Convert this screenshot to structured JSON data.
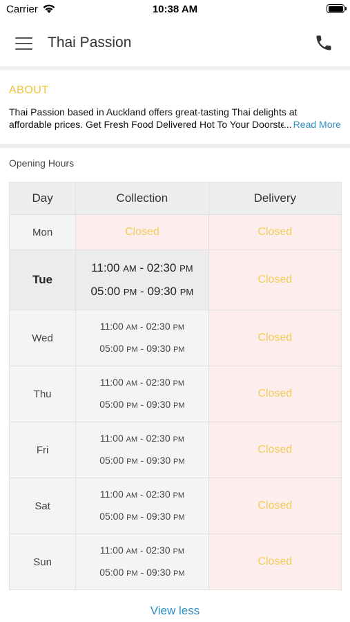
{
  "status_bar": {
    "carrier": "Carrier",
    "time": "10:38 AM"
  },
  "header": {
    "title": "Thai Passion",
    "menu_icon": "hamburger-icon",
    "phone_icon": "phone-icon"
  },
  "about": {
    "heading": "ABOUT",
    "line1": "Thai Passion based in Auckland offers great-tasting Thai delights at",
    "line2": "affordable prices. Get Fresh Food Delivered Hot To Your Doorstep...",
    "ellipsis": "...",
    "read_more": "Read More"
  },
  "hours": {
    "label": "Opening Hours",
    "columns": {
      "day": "Day",
      "collection": "Collection",
      "delivery": "Delivery"
    },
    "days": [
      {
        "day": "Mon",
        "collection_closed": "Closed",
        "delivery": "Closed"
      },
      {
        "day": "Tue",
        "s1_start": "11:00",
        "s1_start_ampm": "AM",
        "sep": " - ",
        "s1_end": "02:30",
        "s1_end_ampm": "PM",
        "s2_start": "05:00",
        "s2_start_ampm": "PM",
        "s2_end": "09:30",
        "s2_end_ampm": "PM",
        "delivery": "Closed"
      },
      {
        "day": "Wed",
        "s1_start": "11:00",
        "s1_start_ampm": "AM",
        "sep": " - ",
        "s1_end": "02:30",
        "s1_end_ampm": "PM",
        "s2_start": "05:00",
        "s2_start_ampm": "PM",
        "s2_end": "09:30",
        "s2_end_ampm": "PM",
        "delivery": "Closed"
      },
      {
        "day": "Thu",
        "s1_start": "11:00",
        "s1_start_ampm": "AM",
        "sep": " - ",
        "s1_end": "02:30",
        "s1_end_ampm": "PM",
        "s2_start": "05:00",
        "s2_start_ampm": "PM",
        "s2_end": "09:30",
        "s2_end_ampm": "PM",
        "delivery": "Closed"
      },
      {
        "day": "Fri",
        "s1_start": "11:00",
        "s1_start_ampm": "AM",
        "sep": " - ",
        "s1_end": "02:30",
        "s1_end_ampm": "PM",
        "s2_start": "05:00",
        "s2_start_ampm": "PM",
        "s2_end": "09:30",
        "s2_end_ampm": "PM",
        "delivery": "Closed"
      },
      {
        "day": "Sat",
        "s1_start": "11:00",
        "s1_start_ampm": "AM",
        "sep": " - ",
        "s1_end": "02:30",
        "s1_end_ampm": "PM",
        "s2_start": "05:00",
        "s2_start_ampm": "PM",
        "s2_end": "09:30",
        "s2_end_ampm": "PM",
        "delivery": "Closed"
      },
      {
        "day": "Sun",
        "s1_start": "11:00",
        "s1_start_ampm": "AM",
        "sep": " - ",
        "s1_end": "02:30",
        "s1_end_ampm": "PM",
        "s2_start": "05:00",
        "s2_start_ampm": "PM",
        "s2_end": "09:30",
        "s2_end_ampm": "PM",
        "delivery": "Closed"
      }
    ]
  },
  "view_less": "View less",
  "colors": {
    "about_heading": "#f0c23b",
    "link": "#2d8fc2",
    "closed_text": "#f2cd57",
    "closed_bg": "#fdeded"
  }
}
